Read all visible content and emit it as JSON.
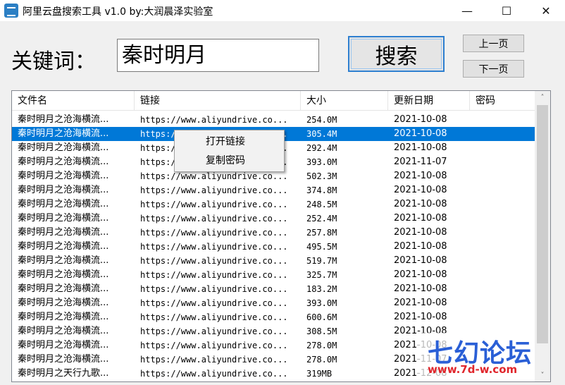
{
  "window": {
    "title": "阿里云盘搜索工具 v1.0  by:大润晨泽实验室",
    "minimize_glyph": "—",
    "maximize_glyph": "☐",
    "close_glyph": "✕"
  },
  "search": {
    "label": "关键词：",
    "value": "秦时明月",
    "button_label": "搜索",
    "prev_page_label": "上一页",
    "next_page_label": "下一页"
  },
  "table": {
    "columns": [
      "文件名",
      "链接",
      "大小",
      "更新日期",
      "密码"
    ],
    "selected_row_index": 1,
    "rows": [
      {
        "name": "秦时明月之沧海横流...",
        "link": "https://www.aliyundrive.co...",
        "size": "254.0M",
        "date": "2021-10-08",
        "password": ""
      },
      {
        "name": "秦时明月之沧海横流...",
        "link": "https://www.aliyundrive.co...",
        "size": "305.4M",
        "date": "2021-10-08",
        "password": ""
      },
      {
        "name": "秦时明月之沧海横流...",
        "link": "https://www.aliyundrive.co...",
        "size": "292.4M",
        "date": "2021-10-08",
        "password": ""
      },
      {
        "name": "秦时明月之沧海横流...",
        "link": "https://www.aliyundrive.co...",
        "size": "393.0M",
        "date": "2021-11-07",
        "password": ""
      },
      {
        "name": "秦时明月之沧海横流...",
        "link": "https://www.aliyundrive.co...",
        "size": "502.3M",
        "date": "2021-10-08",
        "password": ""
      },
      {
        "name": "秦时明月之沧海横流...",
        "link": "https://www.aliyundrive.co...",
        "size": "374.8M",
        "date": "2021-10-08",
        "password": ""
      },
      {
        "name": "秦时明月之沧海横流...",
        "link": "https://www.aliyundrive.co...",
        "size": "248.5M",
        "date": "2021-10-08",
        "password": ""
      },
      {
        "name": "秦时明月之沧海横流...",
        "link": "https://www.aliyundrive.co...",
        "size": "252.4M",
        "date": "2021-10-08",
        "password": ""
      },
      {
        "name": "秦时明月之沧海横流...",
        "link": "https://www.aliyundrive.co...",
        "size": "257.8M",
        "date": "2021-10-08",
        "password": ""
      },
      {
        "name": "秦时明月之沧海横流...",
        "link": "https://www.aliyundrive.co...",
        "size": "495.5M",
        "date": "2021-10-08",
        "password": ""
      },
      {
        "name": "秦时明月之沧海横流...",
        "link": "https://www.aliyundrive.co...",
        "size": "519.7M",
        "date": "2021-10-08",
        "password": ""
      },
      {
        "name": "秦时明月之沧海横流...",
        "link": "https://www.aliyundrive.co...",
        "size": "325.7M",
        "date": "2021-10-08",
        "password": ""
      },
      {
        "name": "秦时明月之沧海横流...",
        "link": "https://www.aliyundrive.co...",
        "size": "183.2M",
        "date": "2021-10-08",
        "password": ""
      },
      {
        "name": "秦时明月之沧海横流...",
        "link": "https://www.aliyundrive.co...",
        "size": "393.0M",
        "date": "2021-10-08",
        "password": ""
      },
      {
        "name": "秦时明月之沧海横流...",
        "link": "https://www.aliyundrive.co...",
        "size": "600.6M",
        "date": "2021-10-08",
        "password": ""
      },
      {
        "name": "秦时明月之沧海横流...",
        "link": "https://www.aliyundrive.co...",
        "size": "308.5M",
        "date": "2021-10-08",
        "password": ""
      },
      {
        "name": "秦时明月之沧海横流...",
        "link": "https://www.aliyundrive.co...",
        "size": "278.0M",
        "date": "2021-10-08",
        "password": ""
      },
      {
        "name": "秦时明月之沧海横流...",
        "link": "https://www.aliyundrive.co...",
        "size": "278.0M",
        "date": "2021-11-07",
        "password": ""
      },
      {
        "name": "秦时明月之天行九歌...",
        "link": "https://www.aliyundrive.co...",
        "size": "319MB",
        "date": "2021-12-08",
        "password": ""
      }
    ]
  },
  "context_menu": {
    "items": [
      "打开链接",
      "复制密码"
    ]
  },
  "scrollbar": {
    "up_glyph": "˄",
    "down_glyph": "˅"
  },
  "watermark": {
    "main": "七幻论坛",
    "url": "www.7d-w.com"
  },
  "colors": {
    "selection": "#0078d7",
    "search_button_border": "#2d7fd0",
    "watermark_blue": "#2a5fd6",
    "watermark_red": "#e0262c"
  }
}
